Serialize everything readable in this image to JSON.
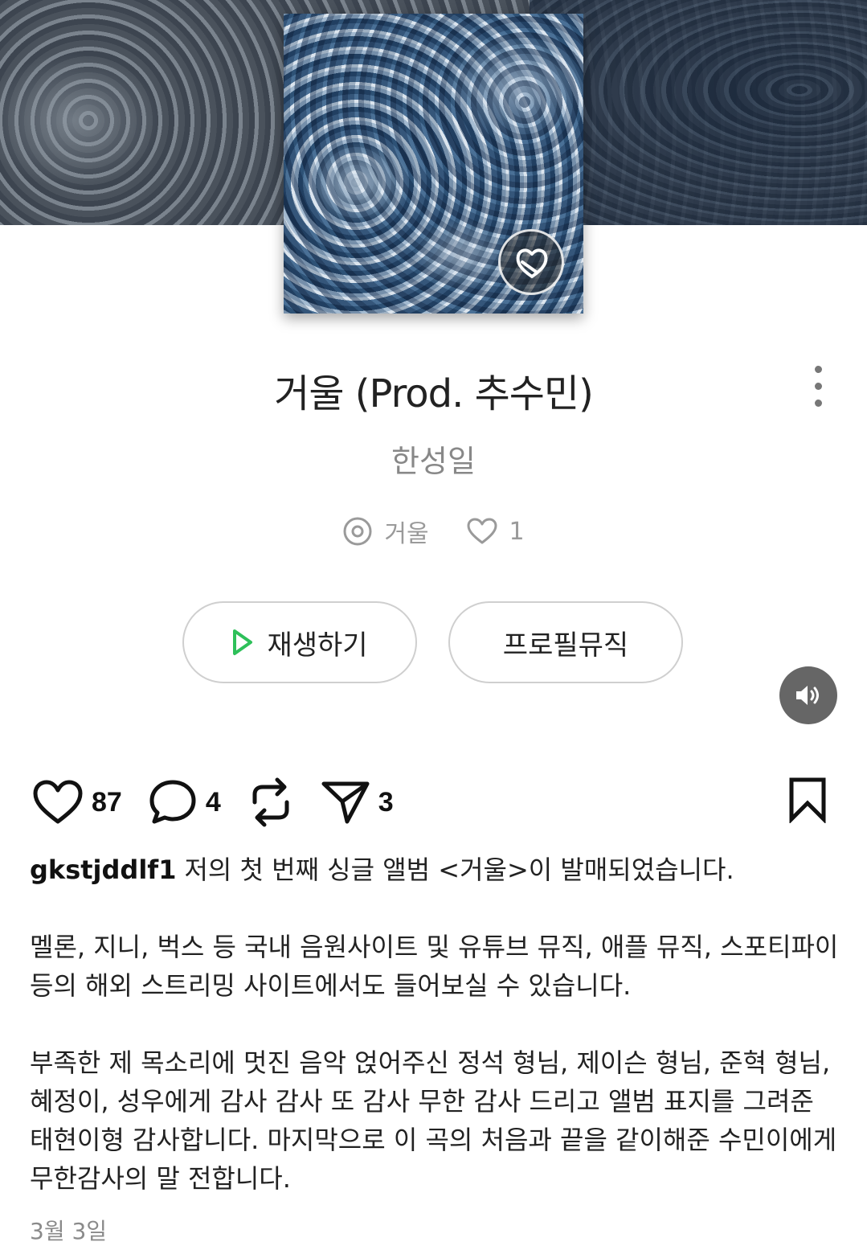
{
  "song": {
    "title": "거울 (Prod. 추수민)",
    "artist": "한성일",
    "album": "거울",
    "likes": "1"
  },
  "buttons": {
    "play_label": "재생하기",
    "profile_label": "프로필뮤직"
  },
  "post": {
    "like_count": "87",
    "comment_count": "4",
    "share_count": "3",
    "username": "gkstjddlf1",
    "paragraphs": [
      "저의 첫 번째 싱글 앨범 <거울>이 발매되었습니다.",
      "멜론, 지니, 벅스 등 국내 음원사이트 및 유튜브 뮤직, 애플 뮤직, 스포티파이 등의 해외 스트리밍 사이트에서도 들어보실 수 있습니다.",
      "부족한 제 목소리에 멋진 음악 얹어주신 정석 형님, 제이슨 형님, 준혁 형님, 혜정이, 성우에게 감사 감사 또 감사 무한 감사 드리고 앨범 표지를 그려준 태현이형 감사합니다. 마지막으로 이 곡의 처음과 끝을 같이해준 수민이에게 무한감사의 말 전합니다."
    ],
    "date": "3월 3일"
  },
  "colors": {
    "play_icon": "#2ec05a",
    "text": "#222222",
    "muted": "#888888"
  }
}
